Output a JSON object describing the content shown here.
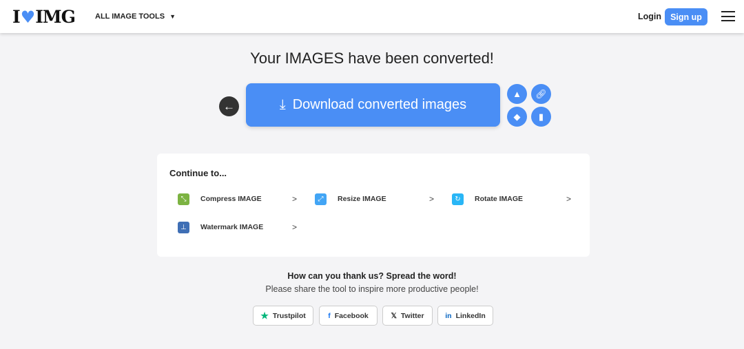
{
  "header": {
    "logo": "I❤IMG",
    "logo_left": "I",
    "logo_right": "IMG",
    "all_tools": "ALL IMAGE TOOLS",
    "login": "Login",
    "signup": "Sign up"
  },
  "main": {
    "title": "Your IMAGES have been converted!",
    "download": "Download converted images"
  },
  "continue": {
    "heading": "Continue to...",
    "items": [
      {
        "label": "Compress IMAGE",
        "color": "#7cb342"
      },
      {
        "label": "Resize IMAGE",
        "color": "#42a5f5"
      },
      {
        "label": "Rotate IMAGE",
        "color": "#29b6f6"
      },
      {
        "label": "Watermark IMAGE",
        "color": "#3f6fb5"
      }
    ]
  },
  "share": {
    "heading": "How can you thank us? Spread the word!",
    "sub": "Please share the tool to inspire more productive people!",
    "buttons": [
      "Trustpilot",
      "Facebook",
      "Twitter",
      "LinkedIn"
    ]
  }
}
